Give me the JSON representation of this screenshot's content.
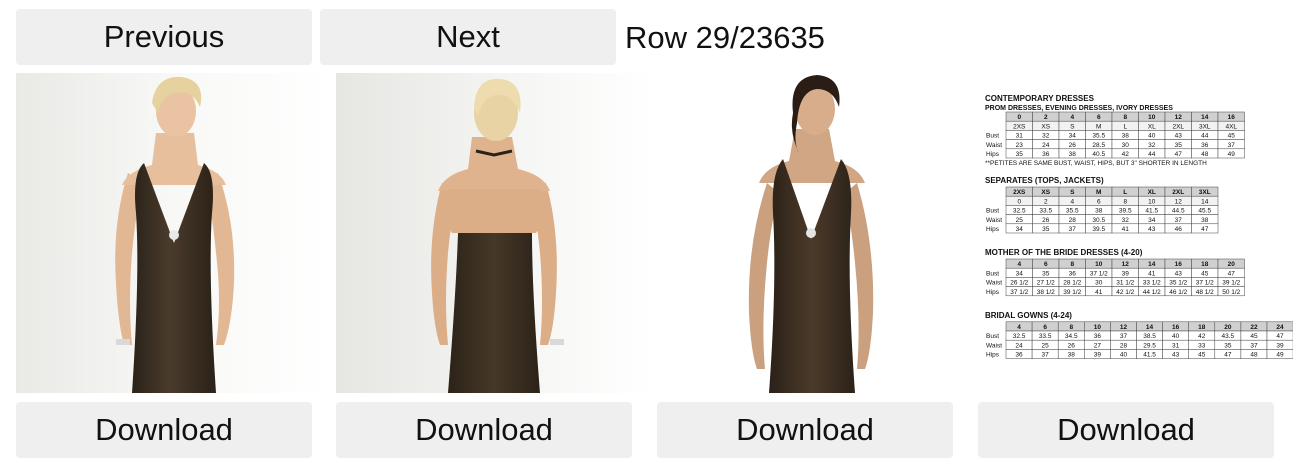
{
  "nav": {
    "previous_label": "Previous",
    "next_label": "Next",
    "row_label": "Row 29/23635"
  },
  "images": [
    {
      "name": "dress-front-blonde"
    },
    {
      "name": "dress-back-blonde"
    },
    {
      "name": "dress-front-brunette"
    },
    {
      "name": "size-chart"
    }
  ],
  "download_label": "Download",
  "colors": {
    "button_bg": "#efefef",
    "dress": "#3e3124"
  },
  "size_chart": {
    "section1_title": "CONTEMPORARY DRESSES",
    "section1_sub": "PROM DRESSES, EVENING DRESSES, IVORY DRESSES",
    "section1_sizes": [
      "0",
      "2",
      "4",
      "6",
      "8",
      "10",
      "12",
      "14",
      "16"
    ],
    "section1_letters": [
      "2XS",
      "XS",
      "S",
      "M",
      "L",
      "XL",
      "2XL",
      "3XL",
      "4XL"
    ],
    "section1_rows": [
      {
        "label": "Bust",
        "values": [
          "31",
          "32",
          "34",
          "35.5",
          "38",
          "40",
          "43",
          "44",
          "45"
        ]
      },
      {
        "label": "Waist",
        "values": [
          "23",
          "24",
          "26",
          "28.5",
          "30",
          "32",
          "35",
          "36",
          "37"
        ]
      },
      {
        "label": "Hips",
        "values": [
          "35",
          "36",
          "38",
          "40.5",
          "42",
          "44",
          "47",
          "48",
          "49"
        ]
      }
    ],
    "section1_note": "**PETITES ARE SAME BUST, WAIST, HIPS, BUT 3\" SHORTER IN LENGTH",
    "section2_title": "SEPARATES (TOPS, JACKETS)",
    "section2_letters": [
      "2XS",
      "XS",
      "S",
      "M",
      "L",
      "XL",
      "2XL",
      "3XL"
    ],
    "section2_sizes": [
      "0",
      "2",
      "4",
      "6",
      "8",
      "10",
      "12",
      "14"
    ],
    "section2_rows": [
      {
        "label": "Bust",
        "values": [
          "32.5",
          "33.5",
          "35.5",
          "38",
          "39.5",
          "41.5",
          "44.5",
          "45.5"
        ]
      },
      {
        "label": "Waist",
        "values": [
          "25",
          "26",
          "28",
          "30.5",
          "32",
          "34",
          "37",
          "38"
        ]
      },
      {
        "label": "Hips",
        "values": [
          "34",
          "35",
          "37",
          "39.5",
          "41",
          "43",
          "46",
          "47"
        ]
      }
    ],
    "section3_title": "MOTHER OF THE BRIDE DRESSES (4-20)",
    "section3_sizes": [
      "4",
      "6",
      "8",
      "10",
      "12",
      "14",
      "16",
      "18",
      "20"
    ],
    "section3_rows": [
      {
        "label": "Bust",
        "values": [
          "34",
          "35",
          "36",
          "37 1/2",
          "39",
          "41",
          "43",
          "45",
          "47"
        ]
      },
      {
        "label": "Waist",
        "values": [
          "26 1/2",
          "27 1/2",
          "28 1/2",
          "30",
          "31 1/2",
          "33 1/2",
          "35 1/2",
          "37 1/2",
          "39 1/2"
        ]
      },
      {
        "label": "Hips",
        "values": [
          "37 1/2",
          "38 1/2",
          "39 1/2",
          "41",
          "42 1/2",
          "44 1/2",
          "46 1/2",
          "48 1/2",
          "50 1/2"
        ]
      }
    ],
    "section4_title": "BRIDAL GOWNS (4-24)",
    "section4_sizes": [
      "4",
      "6",
      "8",
      "10",
      "12",
      "14",
      "16",
      "18",
      "20",
      "22",
      "24"
    ],
    "section4_rows": [
      {
        "label": "Bust",
        "values": [
          "32.5",
          "33.5",
          "34.5",
          "36",
          "37",
          "38.5",
          "40",
          "42",
          "43.5",
          "45",
          "47"
        ]
      },
      {
        "label": "Waist",
        "values": [
          "24",
          "25",
          "26",
          "27",
          "28",
          "29.5",
          "31",
          "33",
          "35",
          "37",
          "39"
        ]
      },
      {
        "label": "Hips",
        "values": [
          "36",
          "37",
          "38",
          "39",
          "40",
          "41.5",
          "43",
          "45",
          "47",
          "48",
          "49"
        ]
      }
    ]
  }
}
